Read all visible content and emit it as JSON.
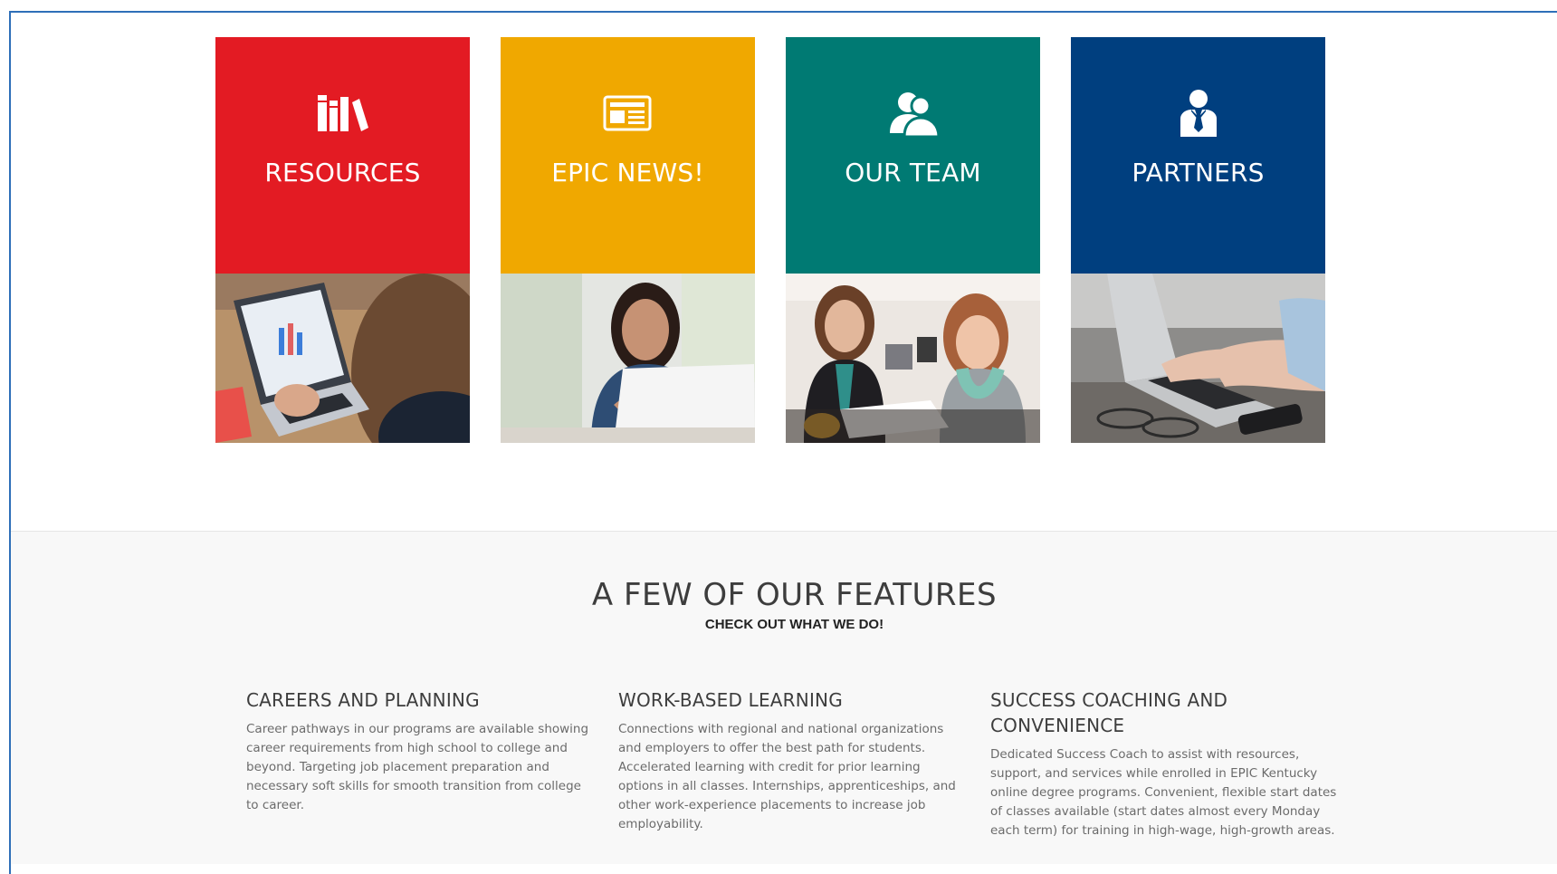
{
  "tiles": [
    {
      "label": "RESOURCES",
      "color": "#e31b23",
      "icon": "books-icon",
      "photo": "laptop-chart-photo"
    },
    {
      "label": "EPIC NEWS!",
      "color": "#f0a800",
      "icon": "newspaper-icon",
      "photo": "woman-laptop-photo"
    },
    {
      "label": "OUR TEAM",
      "color": "#007a73",
      "icon": "team-icon",
      "photo": "team-office-photo"
    },
    {
      "label": "PARTNERS",
      "color": "#003f7f",
      "icon": "businessman-icon",
      "photo": "typing-hands-photo"
    }
  ],
  "features": {
    "title": "A FEW OF OUR FEATURES",
    "subtitle": "CHECK OUT WHAT WE DO!",
    "columns": [
      {
        "heading": "CAREERS AND PLANNING",
        "text": "Career pathways in our programs are available showing career requirements from high school to college and beyond. Targeting job placement preparation and necessary soft skills for smooth transition from college to career."
      },
      {
        "heading": "WORK-BASED LEARNING",
        "text": "Connections with regional and national organizations and employers to offer the best path for students. Accelerated learning with credit for prior learning options in all classes. Internships, apprenticeships, and other work-experience placements to increase job employability."
      },
      {
        "heading": "SUCCESS COACHING AND CONVENIENCE",
        "text": "Dedicated Success Coach to assist with resources, support, and services while enrolled in EPIC Kentucky online degree programs. Convenient, flexible start dates of classes available (start dates almost every Monday each term) for training in high-wage, high-growth areas."
      }
    ]
  }
}
